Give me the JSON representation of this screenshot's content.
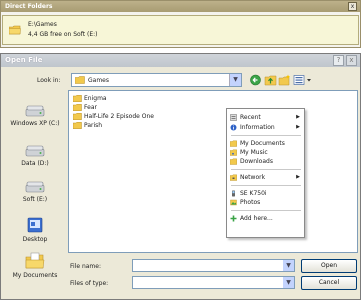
{
  "direct_folders": {
    "title": "Direct Folders",
    "item": {
      "path": "E:\\Games",
      "free_space": "4,4 GB free on Soft (E:)"
    },
    "close_glyph": "x"
  },
  "dialog": {
    "title": "Open File",
    "help_glyph": "?",
    "close_glyph": "x",
    "look_in": {
      "label": "Look in:",
      "value": "Games"
    },
    "places": [
      {
        "label": "Windows XP (C:)",
        "icon": "hard-drive-icon"
      },
      {
        "label": "Data (D:)",
        "icon": "hard-drive-icon"
      },
      {
        "label": "Soft (E:)",
        "icon": "hard-drive-icon"
      },
      {
        "label": "Desktop",
        "icon": "desktop-icon"
      },
      {
        "label": "My Documents",
        "icon": "my-documents-icon"
      }
    ],
    "files": [
      "Enigma",
      "Fear",
      "Half-Life 2 Episode One",
      "Parish"
    ],
    "context_menu": {
      "recent": "Recent",
      "information": "Information",
      "my_documents": "My Documents",
      "my_music": "My Music",
      "downloads": "Downloads",
      "network": "Network",
      "se_k750i": "SE K750i",
      "photos": "Photos",
      "add_here": "Add here..."
    },
    "file_name_label": "File name:",
    "file_name_value": "",
    "file_type_label": "Files of type:",
    "file_type_value": "",
    "open_label": "Open",
    "cancel_label": "Cancel",
    "dropdown_glyph": "▼"
  },
  "colors": {
    "folder": "#f2c94c",
    "dialog_bg": "#ece9d8",
    "title_gradient": "#bfc5cc",
    "panel_highlight": "#f7f6d7",
    "button_border": "#003c74"
  }
}
